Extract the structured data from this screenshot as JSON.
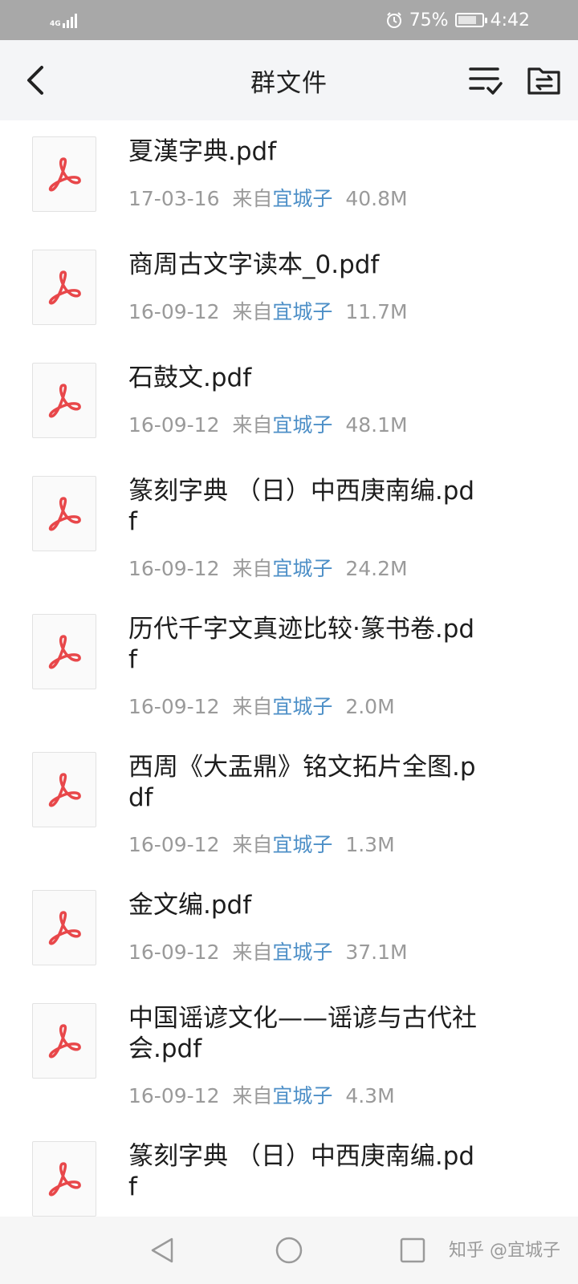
{
  "status_bar": {
    "network": "4G",
    "battery": "75%",
    "battery_level": 0.75,
    "time": "4:42",
    "icons": [
      "signal-icon",
      "alarm-icon",
      "battery-icon"
    ]
  },
  "header": {
    "title": "群文件",
    "icons": [
      "back-arrow-icon",
      "multi-select-icon",
      "folder-transfer-icon"
    ]
  },
  "meta_prefix": "来自",
  "files": [
    {
      "name": "夏漢字典.pdf",
      "date": "17-03-16",
      "sender": "宜城子",
      "size": "40.8M"
    },
    {
      "name": "商周古文字读本_0.pdf",
      "date": "16-09-12",
      "sender": "宜城子",
      "size": "11.7M"
    },
    {
      "name": "石鼓文.pdf",
      "date": "16-09-12",
      "sender": "宜城子",
      "size": "48.1M"
    },
    {
      "name": "篆刻字典 （日）中西庚南编.pdf",
      "date": "16-09-12",
      "sender": "宜城子",
      "size": "24.2M"
    },
    {
      "name": "历代千字文真迹比较·篆书卷.pdf",
      "date": "16-09-12",
      "sender": "宜城子",
      "size": "2.0M"
    },
    {
      "name": "西周《大盂鼎》铭文拓片全图.pdf",
      "date": "16-09-12",
      "sender": "宜城子",
      "size": "1.3M"
    },
    {
      "name": "金文编.pdf",
      "date": "16-09-12",
      "sender": "宜城子",
      "size": "37.1M"
    },
    {
      "name": "中国谣谚文化——谣谚与古代社会.pdf",
      "date": "16-09-12",
      "sender": "宜城子",
      "size": "4.3M"
    },
    {
      "name": "篆刻字典 （日）中西庚南编.pdf",
      "date": "",
      "sender": "",
      "size": ""
    }
  ],
  "nav": {
    "icons": [
      "back-triangle-icon",
      "home-circle-icon",
      "recents-square-icon"
    ],
    "watermark": "知乎 @宜城子"
  },
  "colors": {
    "pdf_red": "#e8474a",
    "sender_blue": "#4d8fc7",
    "meta_gray": "#9a9a9a",
    "header_bg": "#f4f5f7"
  }
}
